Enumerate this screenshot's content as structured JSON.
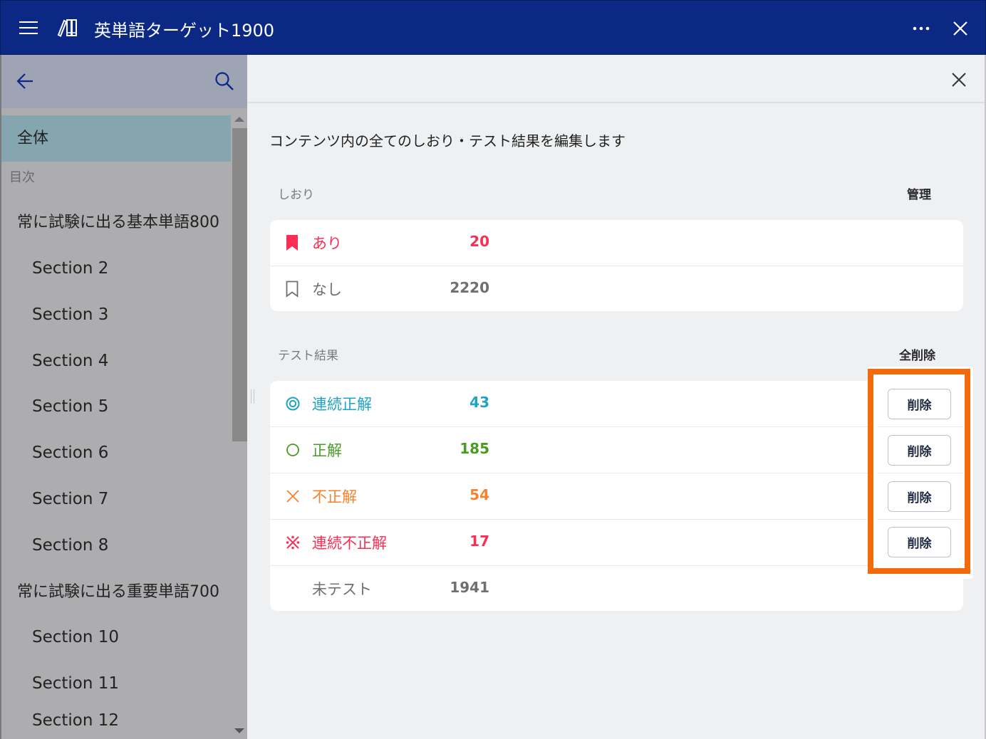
{
  "titlebar": {
    "app_title": "英単語ターゲット1900",
    "icons": {
      "menu": "hamburger-icon",
      "logo": "books-icon",
      "more": "more-horizontal-icon",
      "close": "close-icon"
    }
  },
  "sidebar": {
    "icons": {
      "back": "arrow-left-icon",
      "search": "search-icon"
    },
    "selected_item": "全体",
    "toc_label": "目次",
    "items": [
      {
        "label": "全体",
        "level": 0,
        "selected": true
      },
      {
        "label": "常に試験に出る基本単語800",
        "level": 0
      },
      {
        "label": "Section 2",
        "level": 1
      },
      {
        "label": "Section 3",
        "level": 1
      },
      {
        "label": "Section 4",
        "level": 1
      },
      {
        "label": "Section 5",
        "level": 1
      },
      {
        "label": "Section 6",
        "level": 1
      },
      {
        "label": "Section 7",
        "level": 1
      },
      {
        "label": "Section 8",
        "level": 1
      },
      {
        "label": "常に試験に出る重要単語700",
        "level": 0
      },
      {
        "label": "Section 10",
        "level": 1
      },
      {
        "label": "Section 11",
        "level": 1
      },
      {
        "label": "Section 12",
        "level": 1
      }
    ]
  },
  "main": {
    "description": "コンテンツ内の全てのしおり・テスト結果を編集します",
    "bookmarks": {
      "title": "しおり",
      "action": "管理",
      "rows": [
        {
          "label": "あり",
          "count": "20",
          "icon": "bookmark-filled-icon",
          "color": "#fa2d55"
        },
        {
          "label": "なし",
          "count": "2220",
          "icon": "bookmark-outline-icon",
          "color": "#707070"
        }
      ]
    },
    "tests": {
      "title": "テスト結果",
      "action": "全削除",
      "delete_label": "削除",
      "rows": [
        {
          "label": "連続正解",
          "count": "43",
          "icon": "double-circle-icon",
          "color": "#1ea3c4",
          "deletable": true
        },
        {
          "label": "正解",
          "count": "185",
          "icon": "circle-icon",
          "color": "#4a9a24",
          "deletable": true
        },
        {
          "label": "不正解",
          "count": "54",
          "icon": "cross-icon",
          "color": "#f7812d",
          "deletable": true
        },
        {
          "label": "連続不正解",
          "count": "17",
          "icon": "reference-mark-icon",
          "color": "#fa2d55",
          "deletable": true
        },
        {
          "label": "未テスト",
          "count": "1941",
          "icon": "",
          "color": "#707070",
          "deletable": false
        }
      ]
    }
  },
  "colors": {
    "titlebar": "#0b2885",
    "highlight": "#f26a09",
    "selected_item": "#85a6ae"
  }
}
